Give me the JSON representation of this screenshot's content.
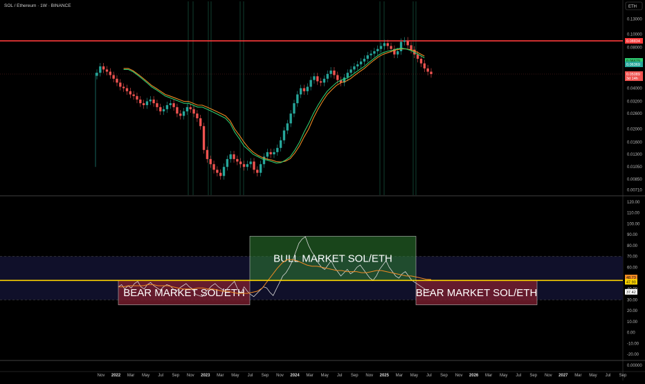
{
  "header": {
    "symbol_line": "SOL / Ethereum · 1W · BINANCE",
    "currency": "ETH"
  },
  "colors": {
    "background": "#000000",
    "bull": "#26a69a",
    "bear": "#ef5350",
    "resistance": "#ff3b3b",
    "ma_fast": "#2ecc71",
    "ma_slow": "#f08a24",
    "threshold": "#ffd400",
    "bull_zone": "#2e7d32",
    "bear_zone": "#7b1e2e",
    "osc_line": "#d9d9d9",
    "osc_ma": "#f08a24"
  },
  "price_axis": {
    "ticks": [
      "0.16000",
      "0.13000",
      "0.10000",
      "0.08000",
      "0.04000",
      "0.03200",
      "0.02600",
      "0.02000",
      "0.01600",
      "0.01300",
      "0.01050",
      "0.00850",
      "0.00710"
    ],
    "tags": [
      {
        "value": "0.08834",
        "color": "#ff3b3b",
        "dark": false
      },
      {
        "value": "0.06679",
        "color": "#2ecc71",
        "dark": true
      },
      {
        "value": "0.06369",
        "color": "#26a69a",
        "dark": false
      },
      {
        "value": "0.05089",
        "color": "#ef5350",
        "dark": false
      },
      {
        "value": "3d 14h",
        "color": "#ef5350",
        "dark": false
      }
    ]
  },
  "osc_axis": {
    "ticks": [
      "120.00",
      "110.00",
      "100.00",
      "90.00",
      "80.00",
      "70.00",
      "60.00",
      "50.00",
      "40.00",
      "30.00",
      "20.00",
      "10.00",
      "0.00",
      "-10.00",
      "-20.00"
    ],
    "tags": [
      {
        "value": "48.73",
        "color": "#f08a24",
        "dark": true
      },
      {
        "value": "47.90",
        "color": "#ffd400",
        "dark": true
      },
      {
        "value": "37.42",
        "color": "#ffffff",
        "dark": true
      }
    ],
    "bottom_value": "0.00000"
  },
  "time_axis": {
    "labels": [
      "Nov",
      "2022",
      "Mar",
      "May",
      "Jul",
      "Sep",
      "Nov",
      "2023",
      "Mar",
      "May",
      "Jul",
      "Sep",
      "Nov",
      "2024",
      "Mar",
      "May",
      "Jul",
      "Sep",
      "Nov",
      "2025",
      "Mar",
      "May",
      "Jul",
      "Sep",
      "Nov",
      "2026",
      "Mar",
      "May",
      "Jul",
      "Sep",
      "Nov",
      "2027",
      "Mar",
      "May",
      "Jul",
      "Sep"
    ]
  },
  "zones": [
    {
      "label": "BEAR MARKET SOL/ETH",
      "kind": "bear"
    },
    {
      "label": "BULL MARKET SOL/ETH",
      "kind": "bull"
    },
    {
      "label": "BEAR MARKET SOL/ETH",
      "kind": "bear"
    }
  ],
  "chart_data": [
    {
      "type": "candlestick",
      "title": "SOL / Ethereum · 1W · BINANCE",
      "scale": "log",
      "ylim": [
        0.0065,
        0.175
      ],
      "x_start": "2021-09",
      "x_end": "2025-06",
      "horizontal_line": 0.0895,
      "last_price": 0.05089,
      "close": [
        0.052,
        0.058,
        0.055,
        0.053,
        0.05,
        0.047,
        0.044,
        0.041,
        0.04,
        0.038,
        0.036,
        0.035,
        0.033,
        0.031,
        0.03,
        0.032,
        0.033,
        0.031,
        0.029,
        0.027,
        0.028,
        0.03,
        0.031,
        0.029,
        0.026,
        0.025,
        0.027,
        0.029,
        0.028,
        0.026,
        0.024,
        0.021,
        0.014,
        0.012,
        0.011,
        0.01,
        0.0095,
        0.009,
        0.0105,
        0.012,
        0.013,
        0.012,
        0.0115,
        0.011,
        0.0105,
        0.011,
        0.0115,
        0.01,
        0.0095,
        0.011,
        0.0125,
        0.0135,
        0.013,
        0.0135,
        0.0145,
        0.0165,
        0.0195,
        0.022,
        0.026,
        0.031,
        0.036,
        0.04,
        0.038,
        0.041,
        0.046,
        0.049,
        0.045,
        0.044,
        0.047,
        0.051,
        0.054,
        0.05,
        0.046,
        0.044,
        0.048,
        0.052,
        0.055,
        0.058,
        0.06,
        0.063,
        0.066,
        0.07,
        0.072,
        0.075,
        0.078,
        0.082,
        0.086,
        0.082,
        0.078,
        0.071,
        0.075,
        0.088,
        0.09,
        0.083,
        0.077,
        0.071,
        0.066,
        0.061,
        0.056,
        0.053,
        0.05089
      ],
      "ma_fast": [
        0.055,
        0.055,
        0.053,
        0.05,
        0.047,
        0.044,
        0.041,
        0.039,
        0.037,
        0.035,
        0.034,
        0.033,
        0.032,
        0.031,
        0.031,
        0.03,
        0.029,
        0.029,
        0.028,
        0.027,
        0.026,
        0.025,
        0.024,
        0.022,
        0.019,
        0.017,
        0.015,
        0.014,
        0.013,
        0.0125,
        0.012,
        0.0118,
        0.0115,
        0.0112,
        0.0113,
        0.0118,
        0.0125,
        0.014,
        0.016,
        0.019,
        0.022,
        0.026,
        0.03,
        0.034,
        0.038,
        0.041,
        0.044,
        0.046,
        0.047,
        0.049,
        0.052,
        0.055,
        0.058,
        0.062,
        0.066,
        0.07,
        0.073,
        0.075,
        0.076,
        0.078,
        0.079,
        0.078,
        0.076,
        0.073,
        0.07,
        0.067
      ],
      "ma_slow": [
        0.056,
        0.056,
        0.054,
        0.051,
        0.048,
        0.045,
        0.042,
        0.04,
        0.038,
        0.036,
        0.035,
        0.034,
        0.033,
        0.032,
        0.032,
        0.031,
        0.03,
        0.03,
        0.029,
        0.028,
        0.027,
        0.026,
        0.025,
        0.023,
        0.02,
        0.018,
        0.016,
        0.0145,
        0.0135,
        0.0128,
        0.0123,
        0.012,
        0.0118,
        0.0115,
        0.0114,
        0.0116,
        0.0121,
        0.0133,
        0.015,
        0.0175,
        0.02,
        0.024,
        0.028,
        0.032,
        0.036,
        0.039,
        0.042,
        0.044,
        0.045,
        0.047,
        0.05,
        0.053,
        0.056,
        0.06,
        0.064,
        0.068,
        0.071,
        0.073,
        0.075,
        0.077,
        0.078,
        0.078,
        0.077,
        0.075,
        0.072,
        0.069
      ]
    },
    {
      "type": "line",
      "ylim": [
        -25,
        125
      ],
      "threshold": 47.9,
      "upper_band": 70,
      "lower_band": 30,
      "series": [
        {
          "values": [
            42,
            44,
            40,
            43,
            41,
            45,
            47,
            42,
            40,
            44,
            46,
            43,
            41,
            39,
            42,
            44,
            43,
            40,
            38,
            41,
            43,
            45,
            42,
            40,
            35,
            34,
            33,
            37,
            40,
            43,
            45,
            42,
            40,
            38,
            41,
            44,
            47,
            40,
            36,
            42,
            38,
            35,
            33,
            36,
            39,
            42,
            41,
            37,
            34,
            40,
            46,
            52,
            55,
            60,
            66,
            74,
            82,
            86,
            88,
            80,
            74,
            70,
            64,
            60,
            58,
            62,
            66,
            60,
            56,
            52,
            55,
            58,
            54,
            56,
            60,
            62,
            58,
            54,
            50,
            48,
            52,
            58,
            62,
            66,
            60,
            56,
            52,
            50,
            54,
            56,
            52,
            48,
            46,
            44,
            42,
            40,
            38,
            37.42
          ]
        },
        {
          "values": [
            42,
            42,
            43,
            43,
            43,
            43,
            44,
            44,
            43,
            43,
            43,
            42,
            41,
            40,
            40,
            40,
            41,
            41,
            40,
            40,
            39,
            38,
            38,
            37,
            36,
            36,
            36,
            37,
            38,
            41,
            47,
            53,
            59,
            64,
            67,
            67,
            66,
            64,
            62,
            61,
            61,
            60,
            59,
            58,
            57,
            57,
            56,
            56,
            56,
            55,
            55,
            56,
            57,
            57,
            56,
            55,
            54,
            53,
            52,
            52,
            51,
            50,
            49,
            48.73
          ]
        }
      ]
    }
  ]
}
